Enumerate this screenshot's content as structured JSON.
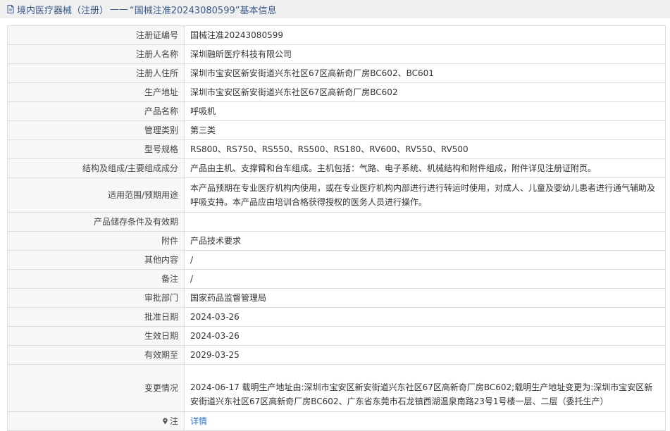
{
  "header": {
    "section": "境内医疗器械（注册）",
    "dash": "——",
    "title": "“国械注准20243080599”基本信息"
  },
  "rows": [
    {
      "label": "注册证编号",
      "value": "国械注准20243080599"
    },
    {
      "label": "注册人名称",
      "value": "深圳融昕医疗科技有限公司"
    },
    {
      "label": "注册人住所",
      "value": "深圳市宝安区新安街道兴东社区67区高新奇厂房BC602、BC601"
    },
    {
      "label": "生产地址",
      "value": "深圳市宝安区新安街道兴东社区67区高新奇厂房BC602"
    },
    {
      "label": "产品名称",
      "value": "呼吸机"
    },
    {
      "label": "管理类别",
      "value": "第三类"
    },
    {
      "label": "型号规格",
      "value": "RS800、RS750、RS550、RS500、RS180、RV600、RV550、RV500"
    },
    {
      "label": "结构及组成/主要组成成分",
      "value": "产品由主机、支撑臂和台车组成。主机包括：气路、电子系统、机械结构和附件组成，附件详见注册证附页。"
    },
    {
      "label": "适用范围/预期用途",
      "value": "本产品预期在专业医疗机构内使用，或在专业医疗机构内部进行进行转运时使用，对成人、儿童及婴幼儿患者进行通气辅助及呼吸支持。本产品应由培训合格获得授权的医务人员进行操作。"
    },
    {
      "label": "产品储存条件及有效期",
      "value": ""
    },
    {
      "label": "附件",
      "value": "产品技术要求"
    },
    {
      "label": "其他内容",
      "value": "/"
    },
    {
      "label": "备注",
      "value": "/"
    },
    {
      "label": "审批部门",
      "value": "国家药品监督管理局"
    },
    {
      "label": "批准日期",
      "value": "2024-03-26"
    },
    {
      "label": "生效日期",
      "value": "2024-03-26"
    },
    {
      "label": "有效期至",
      "value": "2029-03-25"
    },
    {
      "label": "变更情况",
      "value": "2024-06-17 载明生产地址由:深圳市宝安区新安街道兴东社区67区高新奇厂房BC602;载明生产地址变更为:深圳市宝安区新安街道兴东社区67区高新奇厂房BC602、广东省东莞市石龙镇西湖温泉南路23号1号楼一层、二层（委托生产）"
    }
  ],
  "note": {
    "label": "注",
    "link": "详情",
    "icon": "pin-icon"
  },
  "colors": {
    "header_bg": "#f0f0f0",
    "header_text": "#3a5a8a",
    "label_bg": "#f7f7f7",
    "border": "#dcdcdc",
    "link": "#2a6ecb"
  }
}
